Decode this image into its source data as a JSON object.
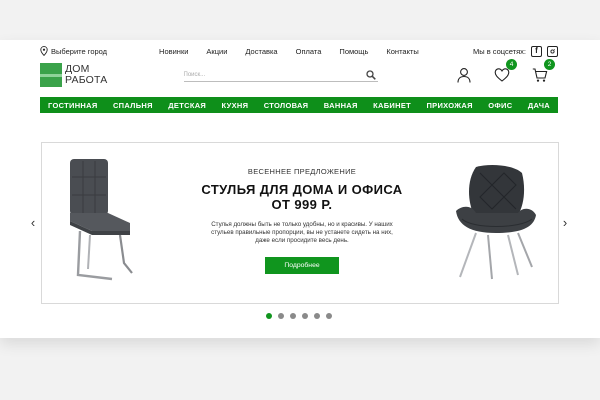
{
  "topbar": {
    "city_label": "Выберите город",
    "nav": [
      "Новинки",
      "Акции",
      "Доставка",
      "Оплата",
      "Помощь",
      "Контакты"
    ],
    "social_label": "Мы в соцсетях:",
    "social_icons": [
      "facebook-icon",
      "instagram-icon"
    ]
  },
  "header": {
    "logo_line1": "ДОМ",
    "logo_line2": "РАБОТА",
    "search_placeholder": "Поиск...",
    "wishlist_count": "4",
    "cart_count": "2"
  },
  "categories": [
    "ГОСТИННАЯ",
    "СПАЛЬНЯ",
    "ДЕТСКАЯ",
    "КУХНЯ",
    "СТОЛОВАЯ",
    "ВАННАЯ",
    "КАБИНЕТ",
    "ПРИХОЖАЯ",
    "ОФИС",
    "ДАЧА"
  ],
  "slide": {
    "kicker": "ВЕСЕННЕЕ ПРЕДЛОЖЕНИЕ",
    "headline_line1": "СТУЛЬЯ ДЛЯ ДОМА И ОФИСА",
    "headline_line2": "ОТ 999 Р.",
    "description": "Стулья должны быть не только удобны, но и красивы. У наших стульев правильные пропорции, вы не устанете сидеть на них, даже если просидите весь день.",
    "button_label": "Подробнее",
    "prev_arrow": "‹",
    "next_arrow": "›"
  },
  "pagination": {
    "count": 6,
    "active": 0
  },
  "colors": {
    "brand_green": "#10951e",
    "nav_green": "#0e8f1a"
  }
}
